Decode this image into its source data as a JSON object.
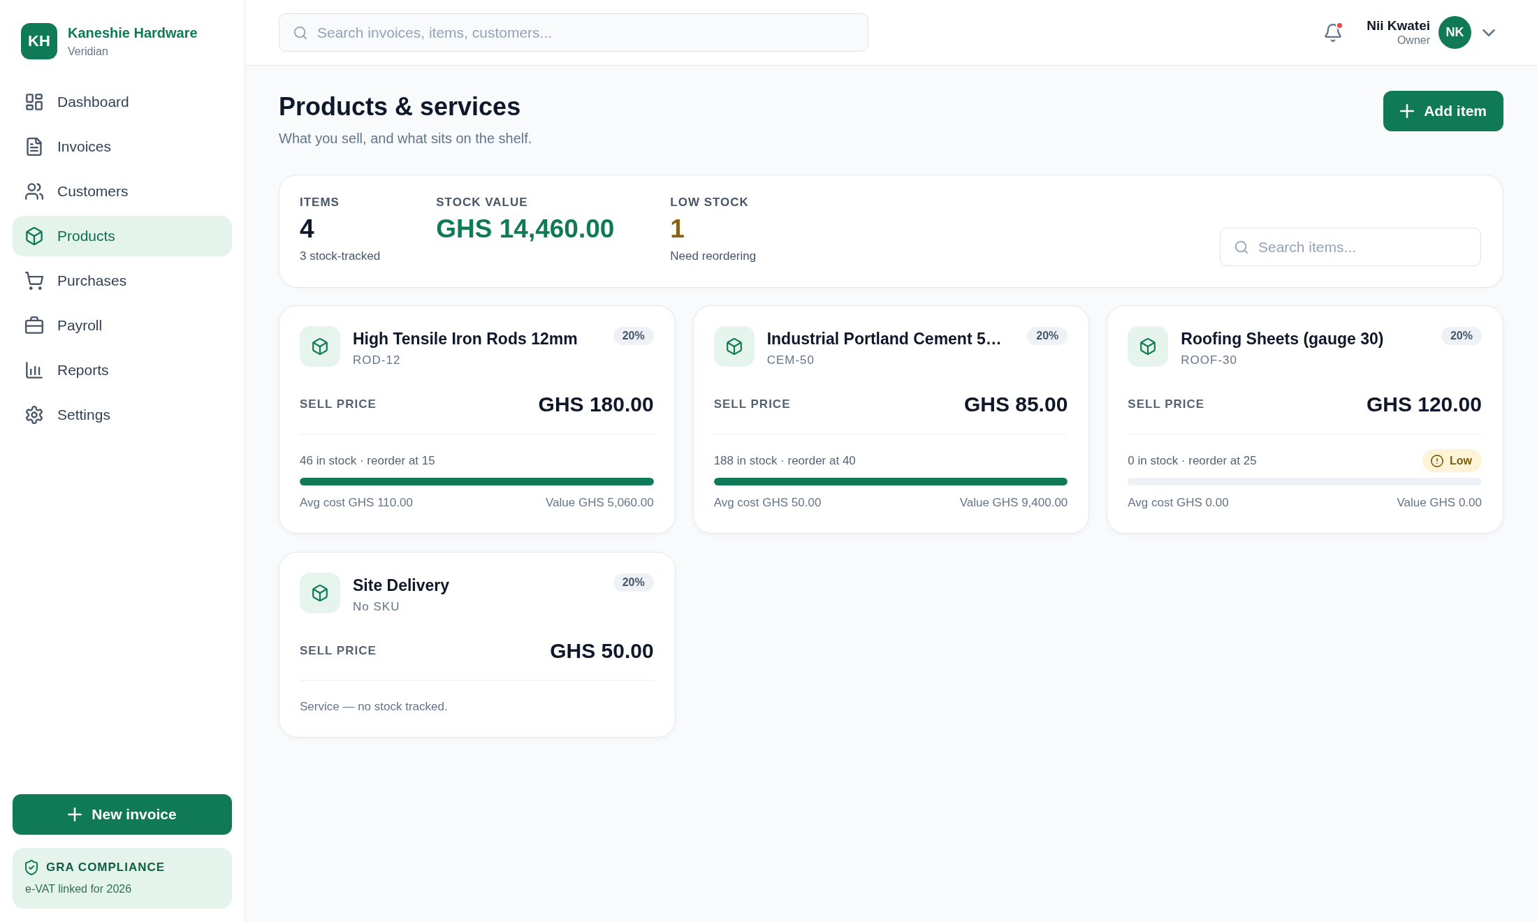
{
  "brand": {
    "initials": "KH",
    "name": "Kaneshie Hardware",
    "subtitle": "Veridian"
  },
  "sidebar": {
    "items": [
      {
        "label": "Dashboard",
        "selected": false
      },
      {
        "label": "Invoices",
        "selected": false
      },
      {
        "label": "Customers",
        "selected": false
      },
      {
        "label": "Products",
        "selected": true
      },
      {
        "label": "Purchases",
        "selected": false
      },
      {
        "label": "Payroll",
        "selected": false
      },
      {
        "label": "Reports",
        "selected": false
      },
      {
        "label": "Settings",
        "selected": false
      }
    ],
    "new_button": "New invoice",
    "compliance": {
      "title": "GRA COMPLIANCE",
      "note": "e-VAT linked for 2026"
    }
  },
  "header": {
    "search": {
      "placeholder": "Search invoices, items, customers..."
    },
    "notifications": {
      "unread": true
    },
    "user": {
      "name": "Nii Kwatei",
      "role": "Owner",
      "initials": "NK"
    }
  },
  "page": {
    "title": "Products & services",
    "subtitle": "What you sell, and what sits on the shelf.",
    "action": "Add item"
  },
  "summary": {
    "stats": [
      {
        "label": "ITEMS",
        "value": "4",
        "note": "3 stock-tracked",
        "color": "#0f172a"
      },
      {
        "label": "STOCK VALUE",
        "value": "GHS 14,460.00",
        "color": "#107a57"
      },
      {
        "label": "LOW STOCK",
        "value": "1",
        "note": "Need reordering",
        "color": "#8a6112"
      }
    ],
    "search": {
      "placeholder": "Search items..."
    }
  },
  "products": [
    {
      "kind": "stock",
      "name": "High Tensile Iron Rods 12mm",
      "sku": "ROD-12",
      "tax": "20%",
      "price_label": "SELL PRICE",
      "price": "GHS 180.00",
      "stock": "46 in stock · reorder at 15",
      "level": 1,
      "avg_cost": "Avg cost GHS 110.00",
      "value": "Value GHS 5,060.00"
    },
    {
      "kind": "stock",
      "name": "Industrial Portland Cement 5…",
      "sku": "CEM-50",
      "tax": "20%",
      "price_label": "SELL PRICE",
      "price": "GHS 85.00",
      "stock": "188 in stock · reorder at 40",
      "level": 1,
      "avg_cost": "Avg cost GHS 50.00",
      "value": "Value GHS 9,400.00"
    },
    {
      "kind": "stock",
      "name": "Roofing Sheets (gauge 30)",
      "sku": "ROOF-30",
      "tax": "20%",
      "price_label": "SELL PRICE",
      "price": "GHS 120.00",
      "stock": "0 in stock · reorder at 25",
      "alert": "Low",
      "level": 0,
      "avg_cost": "Avg cost GHS 0.00",
      "value": "Value GHS 0.00"
    },
    {
      "kind": "service",
      "name": "Site Delivery",
      "sku": "No SKU",
      "tax": "20%",
      "price_label": "SELL PRICE",
      "price": "GHS 50.00",
      "note": "Service — no stock tracked."
    }
  ]
}
